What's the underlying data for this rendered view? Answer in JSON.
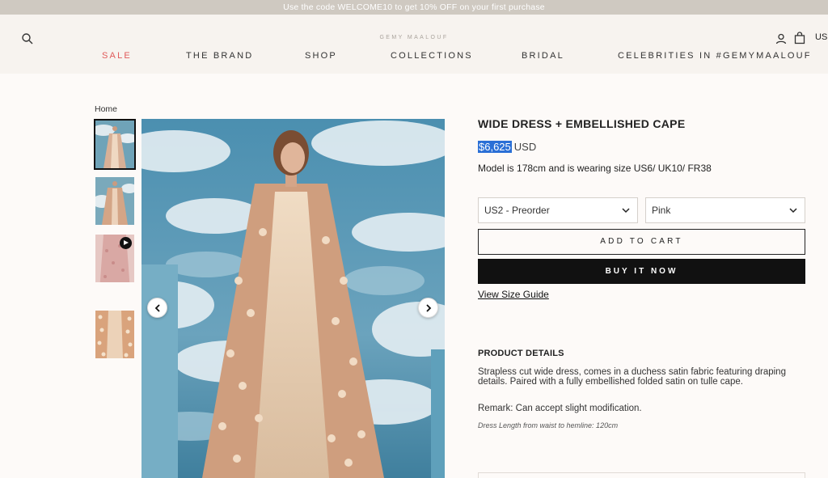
{
  "announcement": "Use the code WELCOME10 to get 10% OFF on your first purchase",
  "header": {
    "logo": "GEMY MAALOUF",
    "currency": "US",
    "icons": {
      "search": "search-icon",
      "account": "user-icon",
      "cart": "bag-icon"
    }
  },
  "nav": {
    "items": [
      "SALE",
      "THE BRAND",
      "SHOP",
      "COLLECTIONS",
      "BRIDAL",
      "CELEBRITIES IN #GEMYMAALOUF"
    ],
    "sale_color": "#e05a5a"
  },
  "breadcrumb": "Home",
  "product": {
    "title": "WIDE DRESS + EMBELLISHED CAPE",
    "price_amount": "$6,625",
    "price_currency": "USD",
    "model_note": "Model is 178cm and is wearing size US6/ UK10/ FR38",
    "size_selected": "US2 - Preorder",
    "color_selected": "Pink",
    "add_to_cart": "ADD TO CART",
    "buy_now": "BUY IT NOW",
    "size_guide": "View Size Guide"
  },
  "details": {
    "heading": "PRODUCT DETAILS",
    "description": "Strapless cut wide dress, comes in a duchess satin fabric featuring draping details. Paired with a fully embellished folded satin on tulle cape.",
    "remark": "Remark: Can accept slight modification.",
    "length": "Dress Length from waist to hemline: 120cm"
  },
  "gallery": {
    "thumbnail_count": 4,
    "video_thumbnail_index": 2
  },
  "colors": {
    "accent_black": "#111111",
    "price_highlight": "#2a6fd6",
    "announcement_bg": "#cfc9c1"
  }
}
